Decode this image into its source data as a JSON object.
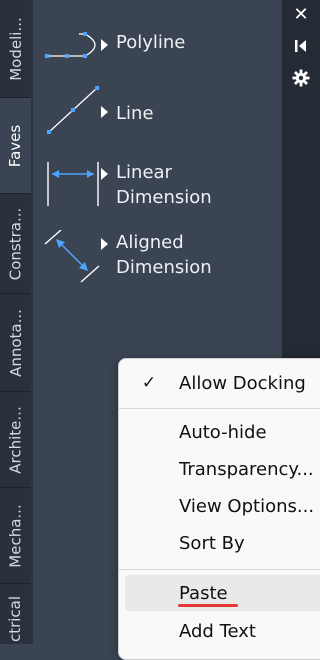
{
  "tabs": [
    {
      "label": "Modeli..."
    },
    {
      "label": "Faves",
      "active": true
    },
    {
      "label": "Constra..."
    },
    {
      "label": "Annota..."
    },
    {
      "label": "Archite..."
    },
    {
      "label": "Mecha..."
    },
    {
      "label": "ctrical"
    }
  ],
  "tools": [
    {
      "label": "Polyline",
      "icon": "polyline-icon"
    },
    {
      "label": "Line",
      "icon": "line-icon"
    },
    {
      "label": "Linear\nDimension",
      "icon": "linear-dimension-icon"
    },
    {
      "label": "Aligned\nDimension",
      "icon": "aligned-dimension-icon"
    }
  ],
  "strip": {
    "close": "✕",
    "icons": [
      "close-icon",
      "collapse-icon",
      "settings-icon"
    ]
  },
  "context_menu": {
    "items": [
      {
        "label": "Allow Docking",
        "checked": true,
        "check_mark": "✓"
      },
      {
        "label": "Auto-hide"
      },
      {
        "label": "Transparency..."
      },
      {
        "label": "View Options..."
      },
      {
        "label": "Sort By"
      },
      {
        "label": "Paste",
        "hovered": true
      },
      {
        "label": "Add Text"
      }
    ]
  },
  "colors": {
    "panel_bg": "#3b4453",
    "tab_bg": "#2a313c",
    "icon_accent": "#4da3ff",
    "underline": "#e53935"
  }
}
